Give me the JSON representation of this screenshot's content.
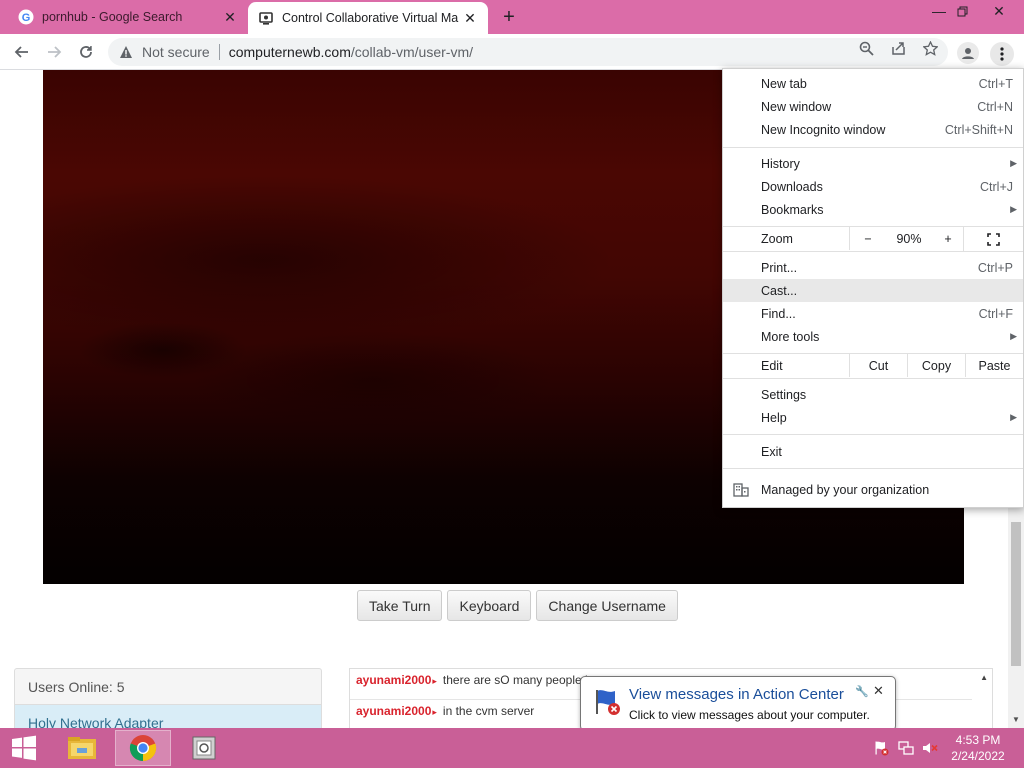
{
  "browser": {
    "tabs": [
      {
        "title": "pornhub - Google Search",
        "icon": "google-icon",
        "active": false
      },
      {
        "title": "Control Collaborative Virtual Ma",
        "icon": "collabvm-icon",
        "active": true
      }
    ],
    "security_label": "Not secure",
    "url_host": "computernewb.com",
    "url_path": "/collab-vm/user-vm/"
  },
  "chrome_menu": {
    "items": [
      {
        "label": "New tab",
        "shortcut": "Ctrl+T"
      },
      {
        "label": "New window",
        "shortcut": "Ctrl+N"
      },
      {
        "label": "New Incognito window",
        "shortcut": "Ctrl+Shift+N"
      },
      {
        "label": "History"
      },
      {
        "label": "Downloads",
        "shortcut": "Ctrl+J"
      },
      {
        "label": "Bookmarks"
      },
      {
        "label": "Print...",
        "shortcut": "Ctrl+P"
      },
      {
        "label": "Cast..."
      },
      {
        "label": "Find...",
        "shortcut": "Ctrl+F"
      },
      {
        "label": "More tools"
      },
      {
        "label": "Settings"
      },
      {
        "label": "Help"
      },
      {
        "label": "Exit"
      }
    ],
    "zoom": {
      "label": "Zoom",
      "minus": "−",
      "value": "90%",
      "plus": "+"
    },
    "edit": {
      "label": "Edit",
      "cut": "Cut",
      "copy": "Copy",
      "paste": "Paste"
    },
    "managed": "Managed by your organization"
  },
  "vm": {
    "buttons": {
      "take_turn": "Take Turn",
      "keyboard": "Keyboard",
      "change_username": "Change Username"
    }
  },
  "users_panel": {
    "header": "Users Online: 5",
    "first_user": "Holy Network Adapter"
  },
  "chat": {
    "messages": [
      {
        "user": "ayunami2000",
        "text": "there are sO many people i"
      },
      {
        "user": "ayunami2000",
        "text": "in the cvm server"
      }
    ]
  },
  "notification": {
    "title": "View messages in Action Center",
    "text": "Click to view messages about your computer."
  },
  "taskbar": {
    "apps": [
      "file-explorer-icon",
      "chrome-icon",
      "vm-app-icon"
    ],
    "time": "4:53 PM",
    "date": "2/24/2022"
  },
  "colors": {
    "tabstrip": "#db6ca8",
    "taskbar": "#c95f97",
    "chat_username": "#d9232d",
    "notification_title": "#1a4e9a"
  }
}
